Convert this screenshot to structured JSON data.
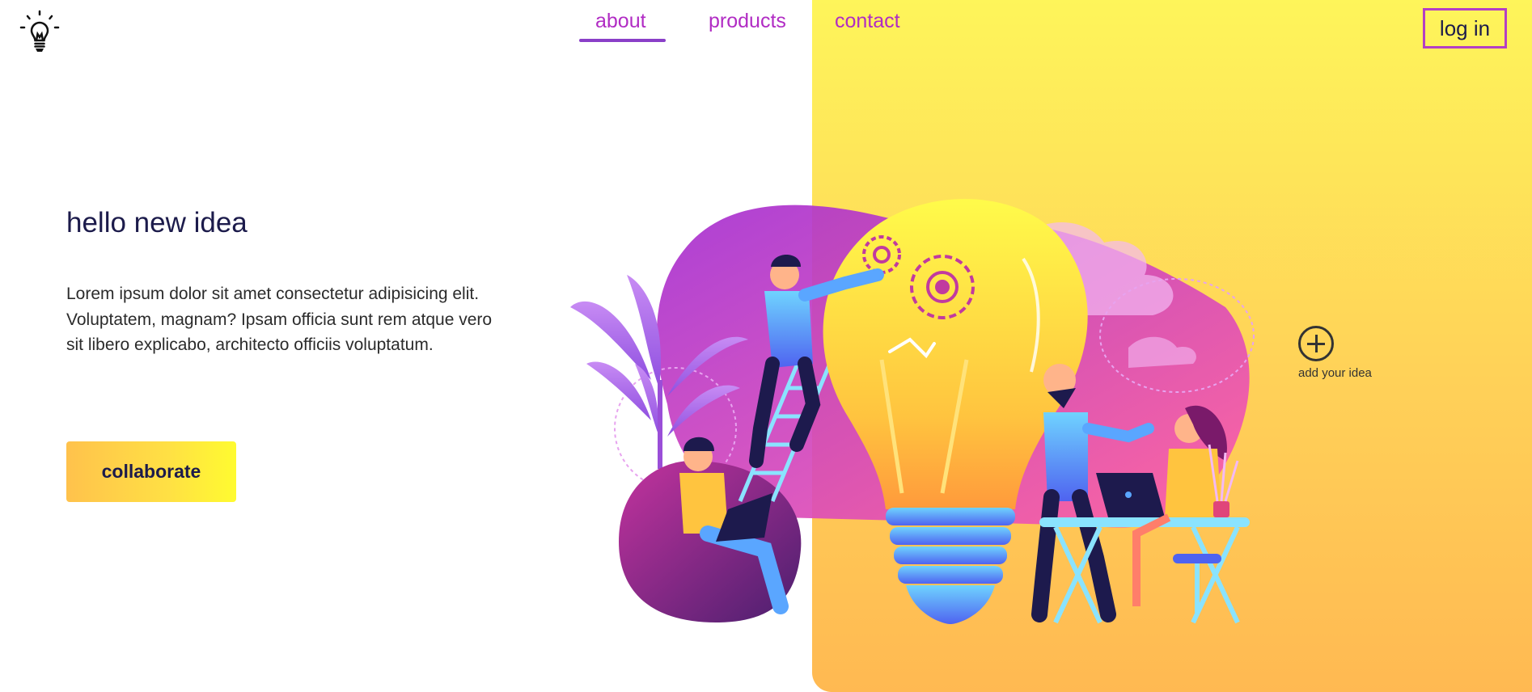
{
  "nav": {
    "links": [
      {
        "label": "about",
        "active": true
      },
      {
        "label": "products",
        "active": false
      },
      {
        "label": "contact",
        "active": false
      }
    ],
    "login_label": "log in"
  },
  "hero": {
    "title": "hello new idea",
    "body": "Lorem ipsum dolor sit amet consectetur adipisicing elit. Voluptatem, magnam? Ipsam officia sunt rem atque vero sit libero explicabo, architecto officiis voluptatum.",
    "cta_label": "collaborate"
  },
  "add_idea": {
    "label": "add your idea",
    "icon": "plus-circle-icon"
  },
  "colors": {
    "nav_link": "#b12cc4",
    "title": "#1c1b4b",
    "panel_top": "#fef55a",
    "panel_bottom": "#ffb952",
    "login_border": "#b43fc4"
  }
}
